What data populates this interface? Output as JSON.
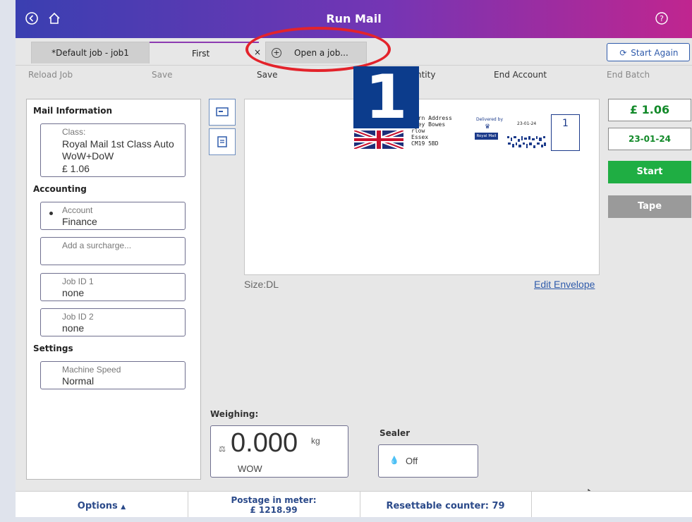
{
  "titlebar": {
    "title": "Run Mail",
    "back_icon": "back-icon",
    "home_icon": "home-icon",
    "help_icon": "help-icon"
  },
  "tabs": [
    {
      "label": "*Default job - job1"
    },
    {
      "label": "First",
      "active": true
    },
    {
      "label": "Open a job..."
    }
  ],
  "tab_close": "×",
  "start_again": "Start Again",
  "toolbar": {
    "reload_job": "Reload Job",
    "save": "Save",
    "save_as": "Save",
    "quantity": "ntity",
    "end_account": "End Account",
    "end_batch": "End Batch"
  },
  "callout_number": "1",
  "mail_information": {
    "title": "Mail Information",
    "class_label": "Class:",
    "class_value": "Royal Mail 1st Class Auto",
    "class_value2": "WoW+DoW",
    "class_price": "£ 1.06"
  },
  "accounting": {
    "title": "Accounting",
    "account_label": "Account",
    "account_value": "Finance",
    "surcharge_placeholder": "Add a surcharge...",
    "job_id1_label": "Job ID 1",
    "job_id1_value": "none",
    "job_id2_label": "Job ID 2",
    "job_id2_value": "none"
  },
  "settings": {
    "title": "Settings",
    "speed_label": "Machine Speed",
    "speed_value": "Normal"
  },
  "envelope": {
    "return_address": [
      "turn Address",
      "tney Bowes",
      "rlow",
      "Essex",
      "CM19 5BD"
    ],
    "delivered_by": "Delivered by",
    "stamp_date": "23-01-24",
    "royal_mail": "Royal Mail",
    "class_num": "1",
    "size_label": "Size:DL",
    "edit_link": "Edit Envelope"
  },
  "right_panel": {
    "price": "£ 1.06",
    "date": "23-01-24",
    "start": "Start",
    "tape": "Tape",
    "accent_green": "#1fae43",
    "tape_grey": "#9a9a9a"
  },
  "weighing": {
    "label": "Weighing:",
    "value": "0.000",
    "unit": "kg",
    "mode": "WOW"
  },
  "sealer": {
    "label": "Sealer",
    "value": "Off"
  },
  "bottombar": {
    "options": "Options",
    "postage_label": "Postage in meter:",
    "postage_value": "£ 1218.99",
    "counter": "Resettable counter: 79"
  }
}
